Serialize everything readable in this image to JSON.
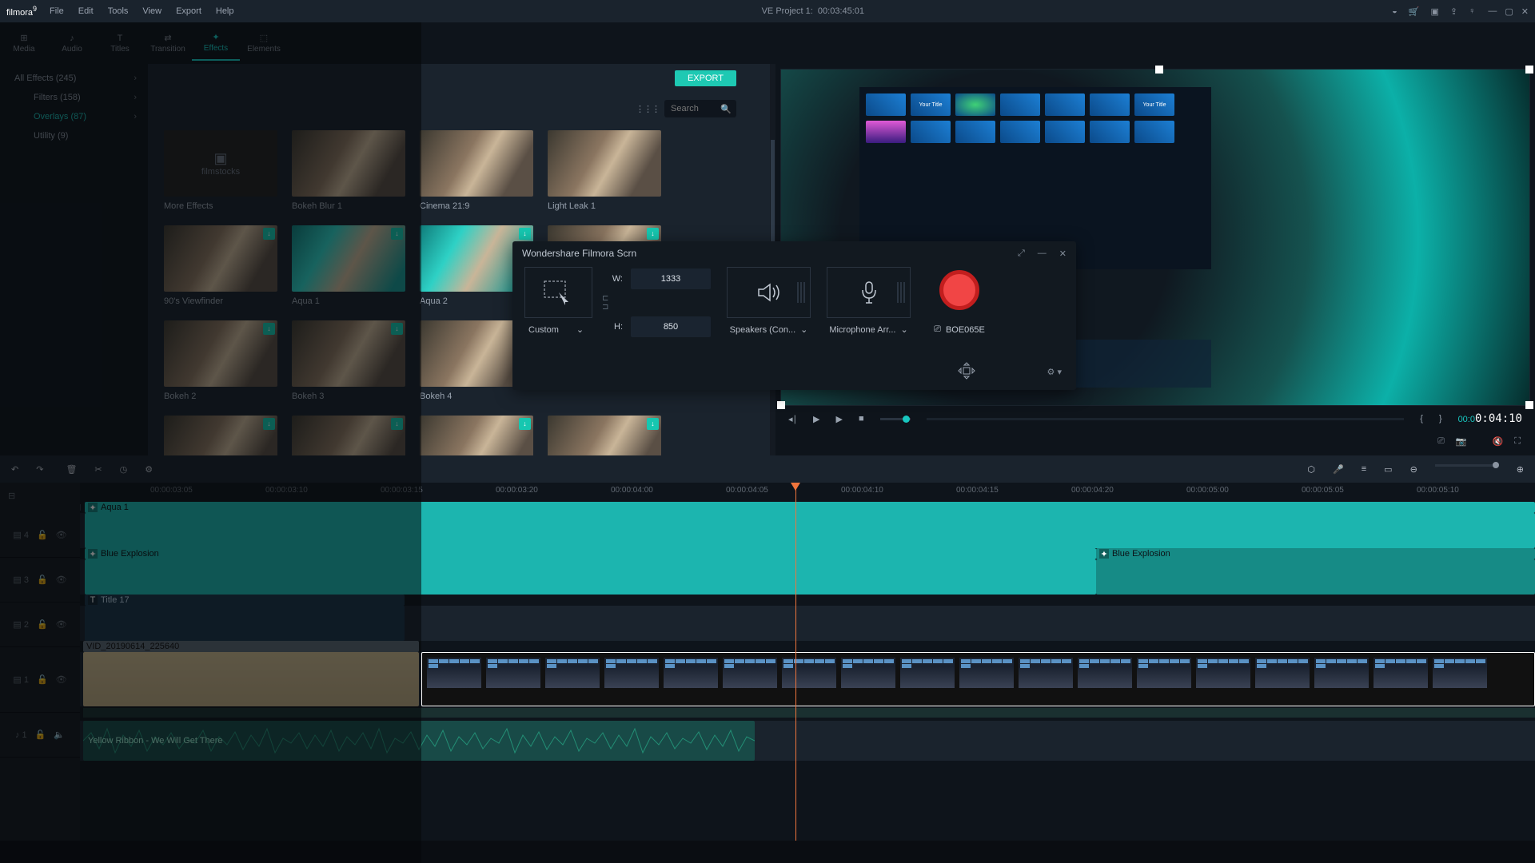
{
  "title": {
    "app": "filmora",
    "app_suffix": "9",
    "project": "VE Project 1:",
    "duration": "00:03:45:01"
  },
  "menus": [
    "File",
    "Edit",
    "Tools",
    "View",
    "Export",
    "Help"
  ],
  "tabs": [
    {
      "key": "media",
      "label": "Media"
    },
    {
      "key": "audio",
      "label": "Audio"
    },
    {
      "key": "titles",
      "label": "Titles"
    },
    {
      "key": "transition",
      "label": "Transition"
    },
    {
      "key": "effects",
      "label": "Effects",
      "active": true
    },
    {
      "key": "elements",
      "label": "Elements"
    }
  ],
  "export": "EXPORT",
  "search": {
    "placeholder": "Search"
  },
  "sidebar": {
    "items": [
      {
        "label": "All Effects (245)",
        "cls": "top"
      },
      {
        "label": "Filters (158)",
        "cls": "sub"
      },
      {
        "label": "Overlays (87)",
        "cls": "sub",
        "active": true
      },
      {
        "label": "Utility (9)",
        "cls": "sub"
      }
    ]
  },
  "effects_grid": {
    "r1": [
      "More Effects",
      "Bokeh Blur 1",
      "Cinema 21:9",
      "Light Leak 1"
    ],
    "r2": [
      "90's Viewfinder",
      "Aqua 1",
      "Aqua 2",
      ""
    ],
    "r3": [
      "Bokeh 2",
      "Bokeh 3",
      "Bokeh 4",
      ""
    ]
  },
  "filmstocks_logo": "filmstocks",
  "preview": {
    "title_chip": "Your Title",
    "transport": {
      "time": "00:00:04:10"
    }
  },
  "scrn": {
    "title": "Wondershare Filmora Scrn",
    "mode": "Custom",
    "width_label": "W:",
    "width": "1333",
    "height_label": "H:",
    "height": "850",
    "speakers": "Speakers (Con...",
    "mic": "Microphone Arr...",
    "device": "BOE065E"
  },
  "timeline": {
    "ticks": [
      "00:00:03:05",
      "00:00:03:10",
      "00:00:03:15",
      "00:00:03:20",
      "00:00:04:00",
      "00:00:04:05",
      "00:00:04:10",
      "00:00:04:15",
      "00:00:04:20",
      "00:00:05:00",
      "00:00:05:05",
      "00:00:05:10"
    ],
    "track4": {
      "id": "4",
      "clip": "Aqua 1"
    },
    "track3": {
      "id": "3",
      "clip": "Blue Explosion",
      "clip2": "Blue Explosion"
    },
    "track2": {
      "id": "2",
      "clip": "Title 17"
    },
    "track1v": {
      "id": "1",
      "clip": "VID_20190614_225640"
    },
    "track1a": {
      "id": "1",
      "clip": "Yellow Ribbon - We Will Get There"
    }
  }
}
